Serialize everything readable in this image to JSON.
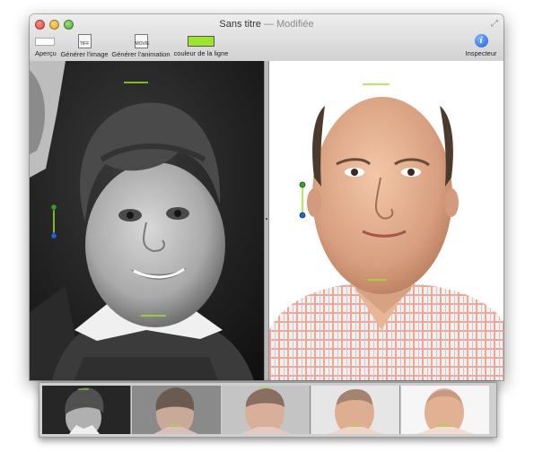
{
  "window": {
    "title": "Sans titre",
    "title_separator": "—",
    "title_status": "Modifiée"
  },
  "toolbar": {
    "items": [
      {
        "label": "Aperçu",
        "icon": "preview-icon"
      },
      {
        "label": "Générer l'image",
        "icon": "image-file-icon",
        "icon_text": "TIFF"
      },
      {
        "label": "Générer l'animation",
        "icon": "movie-file-icon",
        "icon_text": "MOVIE"
      },
      {
        "label": "couleur de la ligne",
        "icon": "color-swatch-icon",
        "color": "#9be52a"
      },
      {
        "label": "Inspecteur",
        "icon": "info-icon",
        "icon_text": "i"
      }
    ]
  },
  "colors": {
    "marker_line": "#9be52a",
    "handle_green": "#3e9d2c",
    "handle_blue": "#2a5fd0"
  },
  "filmstrip": {
    "frame_count": 5
  }
}
